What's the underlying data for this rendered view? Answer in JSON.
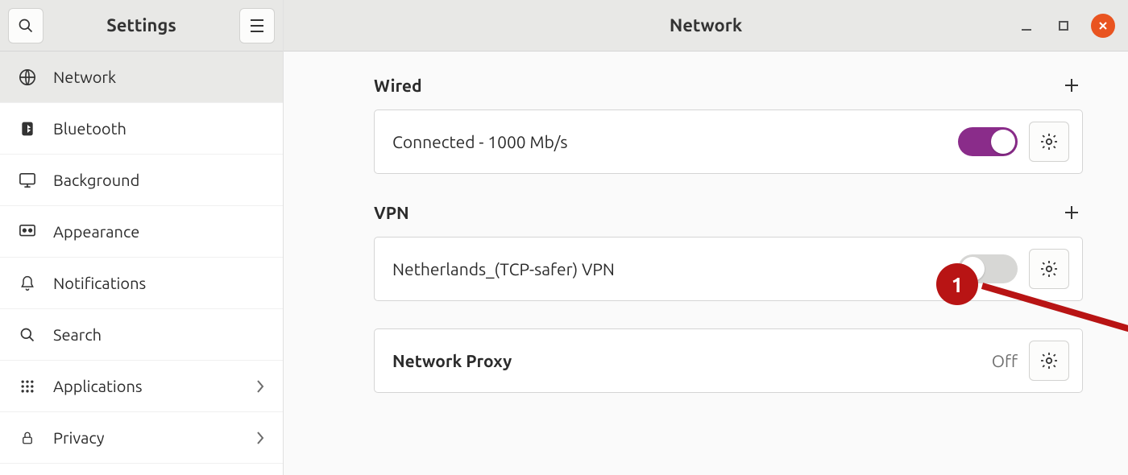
{
  "sidebar": {
    "title": "Settings",
    "items": [
      {
        "label": "Network",
        "icon": "globe",
        "active": true
      },
      {
        "label": "Bluetooth",
        "icon": "bluetooth"
      },
      {
        "label": "Background",
        "icon": "monitor"
      },
      {
        "label": "Appearance",
        "icon": "appearance"
      },
      {
        "label": "Notifications",
        "icon": "bell"
      },
      {
        "label": "Search",
        "icon": "search"
      },
      {
        "label": "Applications",
        "icon": "grid",
        "chevron": true
      },
      {
        "label": "Privacy",
        "icon": "lock",
        "chevron": true
      }
    ]
  },
  "main": {
    "title": "Network",
    "sections": {
      "wired": {
        "heading": "Wired",
        "status": "Connected - 1000 Mb/s",
        "toggle_on": true
      },
      "vpn": {
        "heading": "VPN",
        "connection_name": "Netherlands_(TCP-safer) VPN",
        "toggle_on": false
      },
      "proxy": {
        "heading": "Network Proxy",
        "status": "Off"
      }
    }
  },
  "annotation": {
    "number": "1"
  },
  "colors": {
    "accent_switch_on": "#8a2c8a",
    "close_button": "#e95420",
    "annotation_red": "#b81414"
  }
}
